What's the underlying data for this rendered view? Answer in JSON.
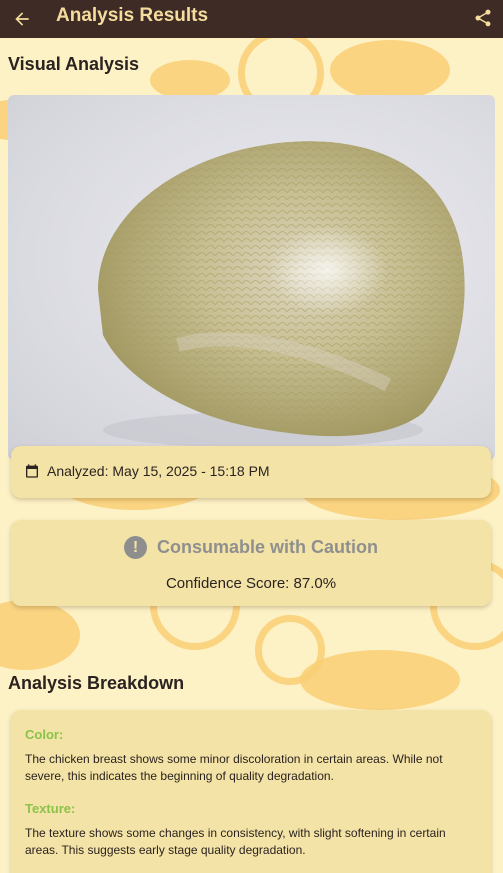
{
  "app_bar": {
    "title": "Analysis Results",
    "back_icon": "arrow-back-icon",
    "share_icon": "share-icon"
  },
  "visual_analysis": {
    "section_title": "Visual Analysis"
  },
  "analysis_date": {
    "icon": "calendar-icon",
    "label": "Analyzed: May 15, 2025 - 15:18 PM"
  },
  "verdict": {
    "icon": "exclamation-circle-icon",
    "status": "Consumable with Caution",
    "confidence": "Confidence Score: 87.0%"
  },
  "breakdown": {
    "section_title": "Analysis Breakdown",
    "items": [
      {
        "heading": "Color:",
        "text": "The chicken breast shows some minor discoloration in certain areas. While not severe, this indicates the beginning of quality degradation."
      },
      {
        "heading": "Texture:",
        "text": "The texture shows some changes in consistency, with slight softening in certain areas. This suggests early stage quality degradation."
      }
    ]
  },
  "colors": {
    "app_bar": "#3f2b25",
    "title_text": "#f5dd9e",
    "background": "#fdf1c6",
    "card": "#f3e3a6",
    "heading_green": "#8bc34a",
    "verdict_grey": "#8f8f8f"
  }
}
